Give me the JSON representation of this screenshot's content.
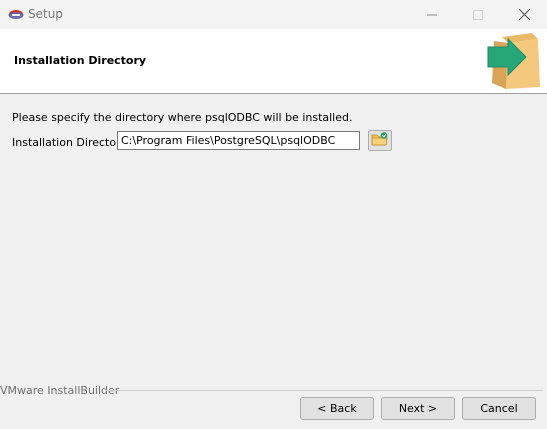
{
  "window": {
    "title": "Setup"
  },
  "header": {
    "title": "Installation Directory"
  },
  "main": {
    "prompt": "Please specify the directory where psqlODBC will be installed.",
    "dir_label": "Installation Directory",
    "dir_value": "C:\\Program Files\\PostgreSQL\\psqlODBC"
  },
  "footer": {
    "brand": "VMware InstallBuilder",
    "back_label": "< Back",
    "next_label": "Next >",
    "cancel_label": "Cancel"
  },
  "icons": {
    "app": "app-icon",
    "browse": "folder-browse-icon",
    "header": "box-arrow-icon"
  },
  "colors": {
    "arrow_green": "#27a67a",
    "box_tan": "#f0c57a"
  }
}
